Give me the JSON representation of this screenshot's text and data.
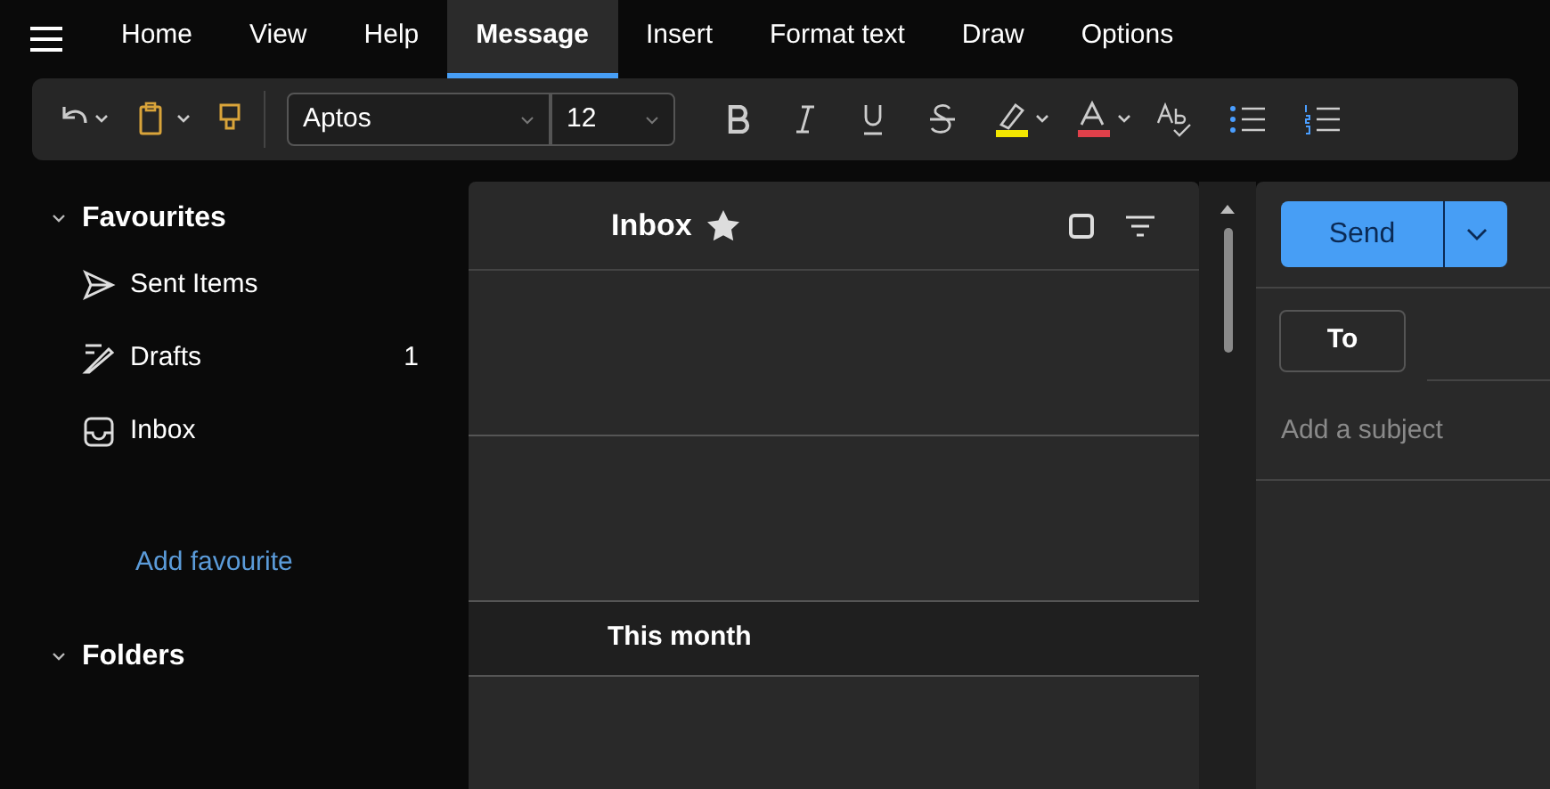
{
  "tabs": [
    {
      "label": "Home",
      "selected": false
    },
    {
      "label": "View",
      "selected": false
    },
    {
      "label": "Help",
      "selected": false
    },
    {
      "label": "Message",
      "selected": true
    },
    {
      "label": "Insert",
      "selected": false
    },
    {
      "label": "Format text",
      "selected": false
    },
    {
      "label": "Draw",
      "selected": false
    },
    {
      "label": "Options",
      "selected": false
    }
  ],
  "toolbar": {
    "font": "Aptos",
    "size": "12"
  },
  "sidebar": {
    "sections": [
      {
        "title": "Favourites",
        "expanded": true,
        "items": [
          {
            "label": "Sent Items",
            "kind": "sent"
          },
          {
            "label": "Drafts",
            "kind": "drafts",
            "count": "1"
          },
          {
            "label": "Inbox",
            "kind": "inbox"
          }
        ],
        "link": "Add favourite"
      },
      {
        "title": "Folders",
        "expanded": true
      }
    ]
  },
  "mail_list": {
    "title": "Inbox",
    "group": "This month"
  },
  "compose": {
    "send": "Send",
    "to": "To",
    "subject_placeholder": "Add a subject"
  }
}
